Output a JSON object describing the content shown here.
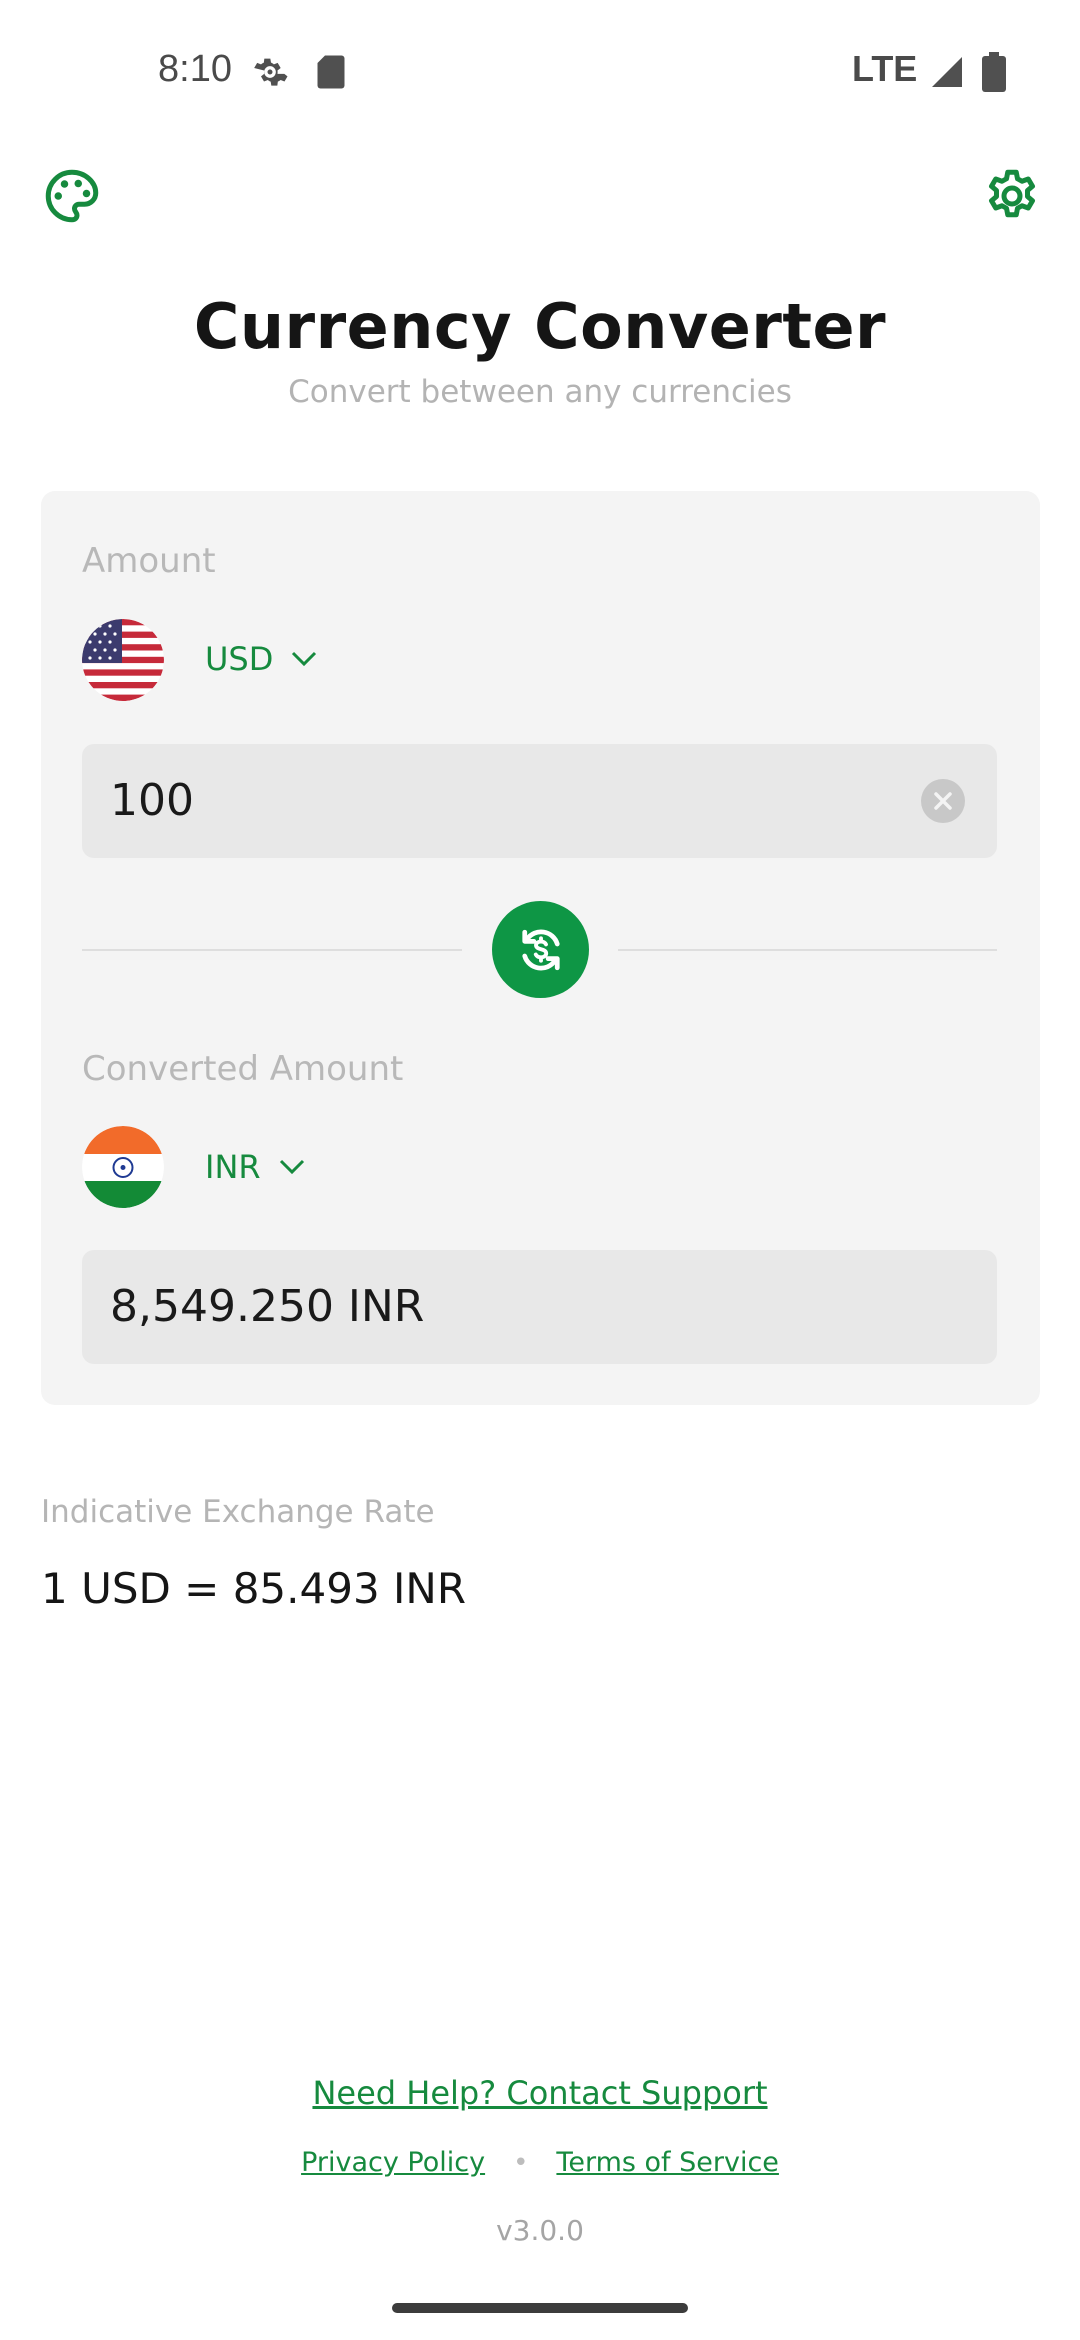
{
  "status_bar": {
    "time": "8:10",
    "network": "LTE",
    "icons": [
      "settings-gear-icon",
      "sd-card-icon",
      "signal-icon",
      "battery-icon"
    ]
  },
  "top_bar": {
    "left_icon": "palette-icon",
    "right_icon": "settings-icon"
  },
  "header": {
    "title": "Currency Converter",
    "subtitle": "Convert between any currencies"
  },
  "converter": {
    "amount_label": "Amount",
    "from_currency": "USD",
    "from_flag": "us-flag-icon",
    "amount_value": "100",
    "swap_icon": "swap-currency-icon",
    "converted_label": "Converted Amount",
    "to_currency": "INR",
    "to_flag": "india-flag-icon",
    "converted_value": "8,549.250 INR"
  },
  "rate": {
    "label": "Indicative Exchange Rate",
    "value": "1 USD = 85.493 INR"
  },
  "footer": {
    "support_link": "Need Help? Contact Support",
    "privacy_link": "Privacy Policy",
    "separator": "•",
    "terms_link": "Terms of Service",
    "version": "v3.0.0"
  },
  "colors": {
    "accent": "#168a3e",
    "swap_button": "#0e9645",
    "card_bg": "#f4f4f4",
    "field_bg": "#e8e8e8"
  }
}
